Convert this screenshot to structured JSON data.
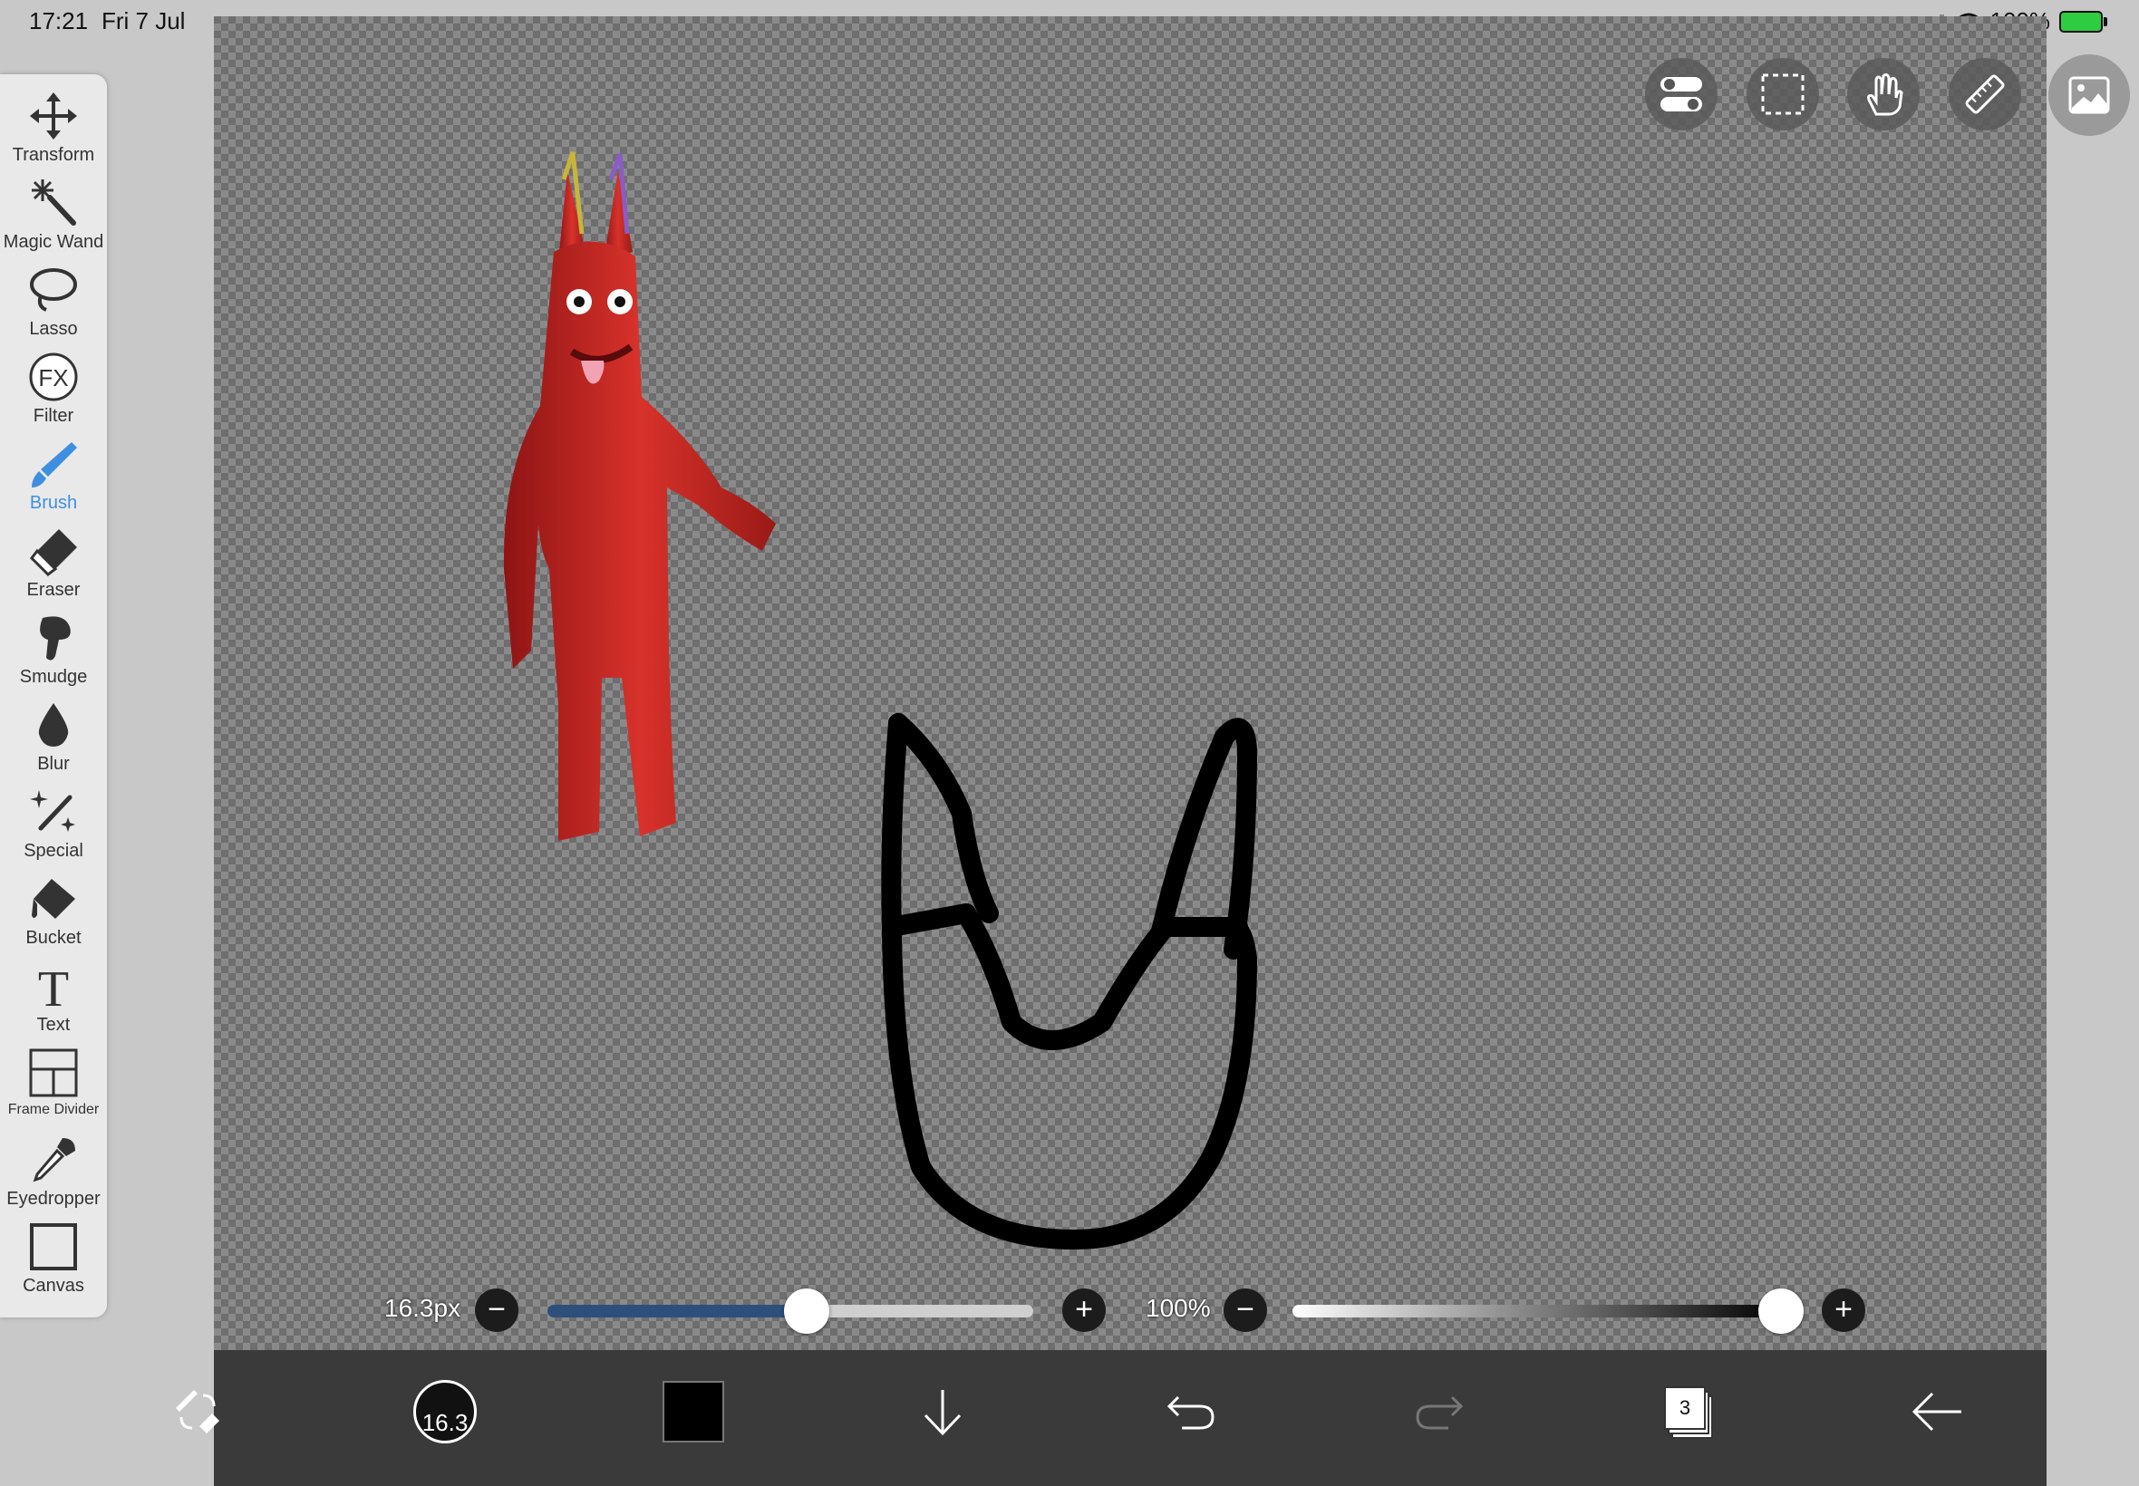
{
  "status_bar": {
    "time": "17:21",
    "date": "Fri 7 Jul",
    "battery": "100%"
  },
  "tools": [
    {
      "label": "Transform",
      "icon": "move-arrows-icon"
    },
    {
      "label": "Magic Wand",
      "icon": "magic-wand-icon"
    },
    {
      "label": "Lasso",
      "icon": "lasso-icon"
    },
    {
      "label": "Filter",
      "icon": "fx-icon"
    },
    {
      "label": "Brush",
      "icon": "brush-icon"
    },
    {
      "label": "Eraser",
      "icon": "eraser-icon"
    },
    {
      "label": "Smudge",
      "icon": "smudge-icon"
    },
    {
      "label": "Blur",
      "icon": "drop-icon"
    },
    {
      "label": "Special",
      "icon": "sparkle-wand-icon"
    },
    {
      "label": "Bucket",
      "icon": "bucket-icon"
    },
    {
      "label": "Text",
      "icon": "text-icon"
    },
    {
      "label": "Frame Divider",
      "icon": "frame-divider-icon"
    },
    {
      "label": "Eyedropper",
      "icon": "eyedropper-icon"
    },
    {
      "label": "Canvas",
      "icon": "canvas-icon"
    }
  ],
  "active_tool": "Brush",
  "top_icons": [
    "toggle-settings-icon",
    "selection-rect-icon",
    "touch-gesture-icon",
    "ruler-icon",
    "gallery-image-icon"
  ],
  "brush_size": {
    "label": "16.3px",
    "fraction": 0.5
  },
  "opacity": {
    "label": "100%",
    "fraction": 1.0
  },
  "bottom_bar": {
    "brush_size_value": "16.3",
    "color": "#000000",
    "layer_count": "3"
  },
  "colors": {
    "active_tool": "#3f8fe0",
    "size_track_fill": "#2d4f7c",
    "bottom_bar": "#3a3a3a"
  }
}
